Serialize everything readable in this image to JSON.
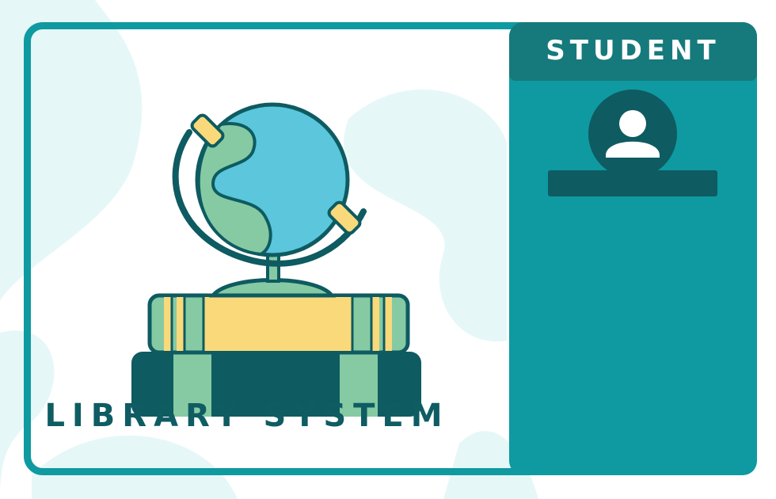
{
  "brand": {
    "title": "LIBRARY SYSTEM"
  },
  "side_panel": {
    "title": "STUDENT"
  },
  "colors": {
    "card_border": "#0E9AA0",
    "panel": "#0E9AA0",
    "panel_header": "#167A7C",
    "dark_teal": "#0E5B61",
    "title_text": "#0F5C63",
    "background_blob": "#E6F7F8",
    "globe_water": "#5BC6DC",
    "globe_land": "#86CAA3",
    "book_yellow": "#FAD97A"
  },
  "icons": {
    "illustration": "globe-on-books-illustration",
    "avatar": "user-avatar-icon"
  }
}
